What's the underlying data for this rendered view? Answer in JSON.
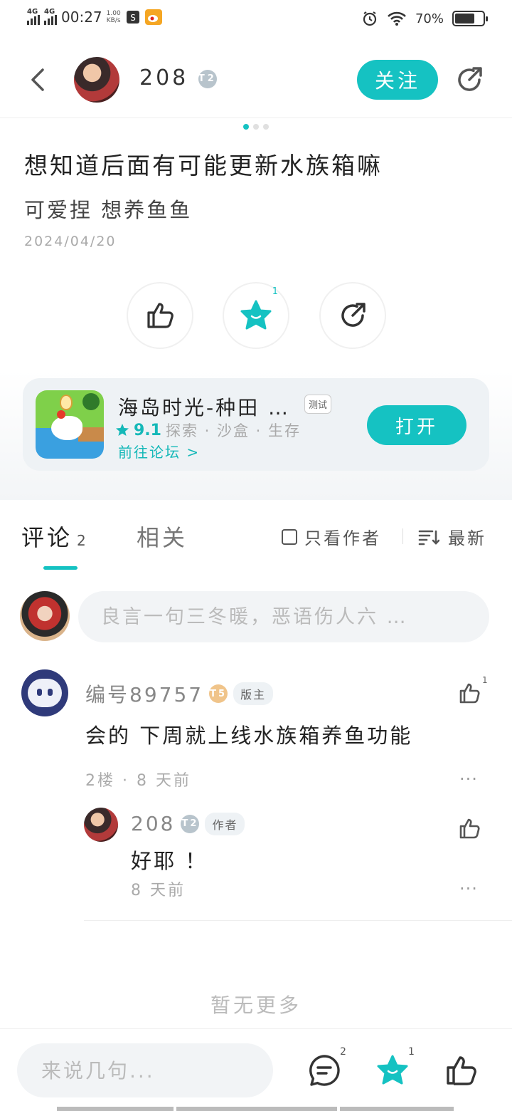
{
  "status_bar": {
    "network1": "4G",
    "network2": "4G",
    "time": "00:27",
    "speed_value": "1.00",
    "speed_unit": "KB/s",
    "battery_percent": "70%",
    "battery_level": 0.7
  },
  "header": {
    "username": "208",
    "level": "T2",
    "follow_label": "关注"
  },
  "post": {
    "title": "想知道后面有可能更新水族箱嘛",
    "body": "可爱捏 想养鱼鱼",
    "date": "2024/04/20",
    "favorite_count": "1",
    "page_indicator": {
      "total": 3,
      "active": 0
    }
  },
  "app_card": {
    "name": "海岛时光-种田 …",
    "tag": "测试",
    "score": "9.1",
    "categories": "探索 · 沙盒 · 生存",
    "forum_link": "前往论坛 >",
    "open_label": "打开"
  },
  "tabs": {
    "comments_label": "评论",
    "comments_count": "2",
    "related_label": "相关",
    "author_only_label": "只看作者",
    "sort_label": "最新"
  },
  "comment_input": {
    "placeholder": "良言一句三冬暖，恶语伤人六 …"
  },
  "comments": [
    {
      "author": "编号89757",
      "level": "T5",
      "role": "版主",
      "text": "会的 下周就上线水族箱养鱼功能",
      "meta": "2楼 · 8 天前",
      "likes": "1",
      "more": "···"
    }
  ],
  "reply": {
    "author": "208",
    "level": "T2",
    "role": "作者",
    "text": "好耶 ！",
    "meta": "8 天前",
    "more": "···"
  },
  "no_more": "暂无更多",
  "bottom_bar": {
    "input_placeholder": "来说几句...",
    "comment_count": "2",
    "favorite_count": "1"
  },
  "colors": {
    "accent": "#15c2c2",
    "text_primary": "#222222",
    "text_muted": "#aaaaaa"
  }
}
